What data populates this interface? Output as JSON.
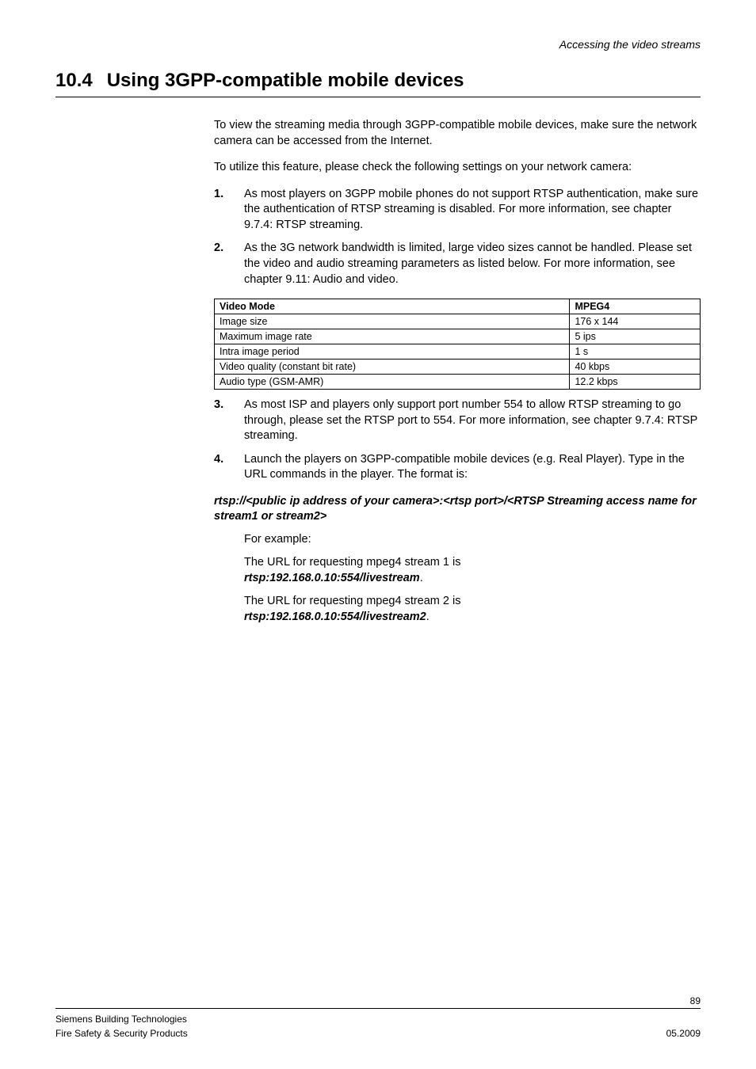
{
  "header": {
    "breadcrumb": "Accessing the video streams"
  },
  "section": {
    "number": "10.4",
    "title": "Using 3GPP-compatible mobile devices"
  },
  "intro1": "To view the streaming media through 3GPP-compatible mobile devices, make sure the network camera can be accessed from the Internet.",
  "intro2": "To utilize this feature, please check the following settings on your network camera:",
  "steps_a": [
    {
      "n": "1.",
      "t": "As most players on 3GPP mobile phones do not support RTSP authentication, make sure the authentication of RTSP streaming is disabled. For more information, see chapter 9.7.4: RTSP streaming."
    },
    {
      "n": "2.",
      "t": "As the 3G network bandwidth is limited, large video sizes cannot be handled. Please set the video and audio streaming parameters as listed below. For more information, see chapter 9.11: Audio and video."
    }
  ],
  "table": {
    "head": [
      "Video Mode",
      "MPEG4"
    ],
    "rows": [
      [
        "Image size",
        "176 x 144"
      ],
      [
        "Maximum image rate",
        "5 ips"
      ],
      [
        "Intra image period",
        "1 s"
      ],
      [
        "Video quality (constant bit rate)",
        "40 kbps"
      ],
      [
        "Audio type (GSM-AMR)",
        "12.2 kbps"
      ]
    ]
  },
  "steps_b": [
    {
      "n": "3.",
      "t": "As most ISP and players only support port number 554 to allow RTSP streaming to go through, please set the RTSP port to 554. For more information, see chapter 9.7.4: RTSP streaming."
    },
    {
      "n": "4.",
      "t": "Launch the players on 3GPP-compatible mobile devices (e.g. Real Player). Type in the URL commands in the player. The format is:"
    }
  ],
  "format_line": "rtsp://<public ip address of your camera>:<rtsp port>/<RTSP Streaming access name for stream1 or stream2>",
  "example_label": "For example:",
  "ex1_text": "The URL for requesting mpeg4 stream 1 is ",
  "ex1_url": "rtsp:192.168.0.10:554/livestream",
  "ex1_period": ".",
  "ex2_text": "The URL for requesting mpeg4 stream 2 is ",
  "ex2_url": "rtsp:192.168.0.10:554/livestream2",
  "ex2_period": ".",
  "footer": {
    "page": "89",
    "line1": "Siemens Building Technologies",
    "line2": "Fire Safety & Security Products",
    "date": "05.2009"
  }
}
